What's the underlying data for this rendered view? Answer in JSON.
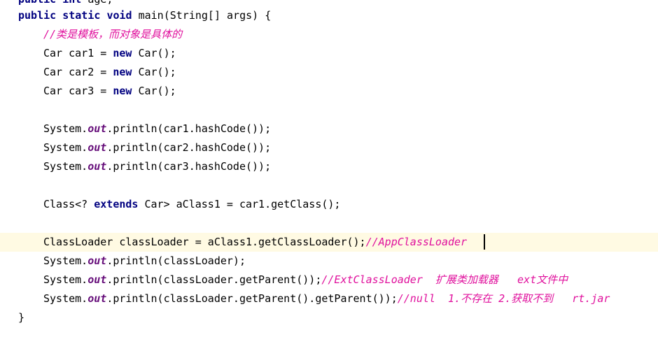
{
  "lines": {
    "l0": {
      "kw1": "public",
      "kw2": "int",
      "rest": " age;"
    },
    "l1": {
      "kw1": "public",
      "kw2": "static",
      "kw3": "void",
      "rest": " main(String[] args) {"
    },
    "l2": {
      "comment": "//类是模板，而对象是具体的"
    },
    "l3": {
      "pre": "Car car1 = ",
      "kw": "new",
      "post": " Car();"
    },
    "l4": {
      "pre": "Car car2 = ",
      "kw": "new",
      "post": " Car();"
    },
    "l5": {
      "pre": "Car car3 = ",
      "kw": "new",
      "post": " Car();"
    },
    "l7": {
      "pre": "System.",
      "field": "out",
      "post": ".println(car1.hashCode());"
    },
    "l8": {
      "pre": "System.",
      "field": "out",
      "post": ".println(car2.hashCode());"
    },
    "l9": {
      "pre": "System.",
      "field": "out",
      "post": ".println(car3.hashCode());"
    },
    "l11": {
      "pre": "Class<? ",
      "kw": "extends",
      "post": " Car> aClass1 = car1.getClass();"
    },
    "l13": {
      "code": "ClassLoader classLoader = aClass1.getClassLoader();",
      "comment": "//AppClassLoader"
    },
    "l14": {
      "pre": "System.",
      "field": "out",
      "post": ".println(classLoader);"
    },
    "l15": {
      "pre": "System.",
      "field": "out",
      "post": ".println(classLoader.getParent());",
      "comment": "//ExtClassLoader  扩展类加载器   ext文件中"
    },
    "l16": {
      "pre": "System.",
      "field": "out",
      "post": ".println(classLoader.getParent().getParent());",
      "comment": "//null  1.不存在 2.获取不到   rt.jar"
    },
    "l17": {
      "code": "}"
    }
  }
}
